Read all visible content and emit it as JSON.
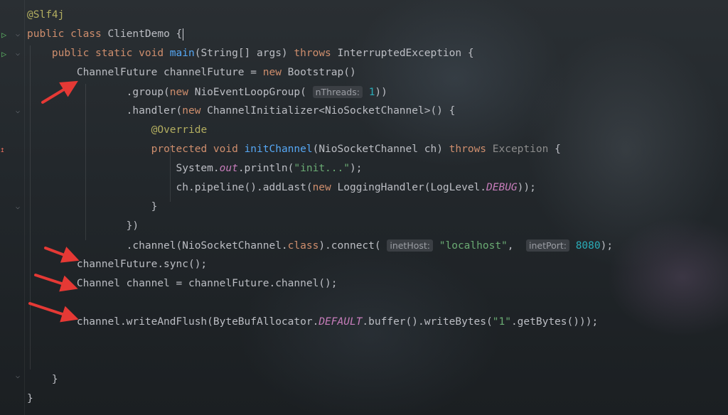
{
  "code": {
    "lines": [
      [
        {
          "t": "@Slf4j",
          "c": "ann"
        }
      ],
      [
        {
          "t": "public class ",
          "c": "kw"
        },
        {
          "t": "ClientDemo "
        },
        {
          "t": "{",
          "c": "caret"
        }
      ],
      [
        {
          "t": "    "
        },
        {
          "t": "public static void ",
          "c": "kw"
        },
        {
          "t": "main",
          "c": "fn"
        },
        {
          "t": "(String[] args) "
        },
        {
          "t": "throws ",
          "c": "kw"
        },
        {
          "t": "InterruptedException {"
        }
      ],
      [
        {
          "t": "        ChannelFuture channelFuture = "
        },
        {
          "t": "new ",
          "c": "kw"
        },
        {
          "t": "Bootstrap()"
        }
      ],
      [
        {
          "t": "                .group("
        },
        {
          "t": "new ",
          "c": "kw"
        },
        {
          "t": "NioEventLoopGroup( "
        },
        {
          "t": "nThreads:",
          "c": "hint"
        },
        {
          "t": " "
        },
        {
          "t": "1",
          "c": "num"
        },
        {
          "t": "))"
        }
      ],
      [
        {
          "t": "                .handler("
        },
        {
          "t": "new ",
          "c": "kw"
        },
        {
          "t": "ChannelInitializer<NioSocketChannel>() {"
        }
      ],
      [
        {
          "t": "                    "
        },
        {
          "t": "@Override",
          "c": "ann"
        }
      ],
      [
        {
          "t": "                    "
        },
        {
          "t": "protected void ",
          "c": "kw"
        },
        {
          "t": "initChannel",
          "c": "fn"
        },
        {
          "t": "(NioSocketChannel ch) "
        },
        {
          "t": "throws ",
          "c": "kw"
        },
        {
          "t": "Exception ",
          "c": "grey"
        },
        {
          "t": "{"
        }
      ],
      [
        {
          "t": "                        System."
        },
        {
          "t": "out",
          "c": "it"
        },
        {
          "t": ".println("
        },
        {
          "t": "\"init...\"",
          "c": "str"
        },
        {
          "t": ");"
        }
      ],
      [
        {
          "t": "                        ch.pipeline().addLast("
        },
        {
          "t": "new ",
          "c": "kw"
        },
        {
          "t": "LoggingHandler(LogLevel."
        },
        {
          "t": "DEBUG",
          "c": "it"
        },
        {
          "t": "));"
        }
      ],
      [
        {
          "t": "                    }"
        }
      ],
      [
        {
          "t": "                })"
        }
      ],
      [
        {
          "t": "                .channel(NioSocketChannel."
        },
        {
          "t": "class",
          "c": "kw"
        },
        {
          "t": ").connect( "
        },
        {
          "t": "inetHost:",
          "c": "hint"
        },
        {
          "t": " "
        },
        {
          "t": "\"localhost\"",
          "c": "str"
        },
        {
          "t": ",  "
        },
        {
          "t": "inetPort:",
          "c": "hint"
        },
        {
          "t": " "
        },
        {
          "t": "8080",
          "c": "num"
        },
        {
          "t": ");"
        }
      ],
      [
        {
          "t": "        channelFuture.sync();"
        }
      ],
      [
        {
          "t": "        Channel channel = channelFuture.channel();"
        }
      ],
      [],
      [
        {
          "t": "        channel.writeAndFlush(ByteBufAllocator."
        },
        {
          "t": "DEFAULT",
          "c": "it"
        },
        {
          "t": ".buffer().writeBytes("
        },
        {
          "t": "\"1\"",
          "c": "str"
        },
        {
          "t": ".getBytes()));"
        }
      ],
      [],
      [],
      [
        {
          "t": "    }"
        }
      ],
      [
        {
          "t": "}"
        }
      ]
    ]
  },
  "gutter": {
    "run_icon": "run-arrow-icon",
    "override_icon": "override-marker-icon",
    "fold_icon": "fold-chevron-icon"
  },
  "colors": {
    "keyword": "#cf8e6d",
    "function": "#56a8f5",
    "string": "#6aab73",
    "number": "#2aacb8",
    "annotation": "#b3ae60",
    "static_field": "#c77dbb",
    "arrow": "#e53935"
  }
}
